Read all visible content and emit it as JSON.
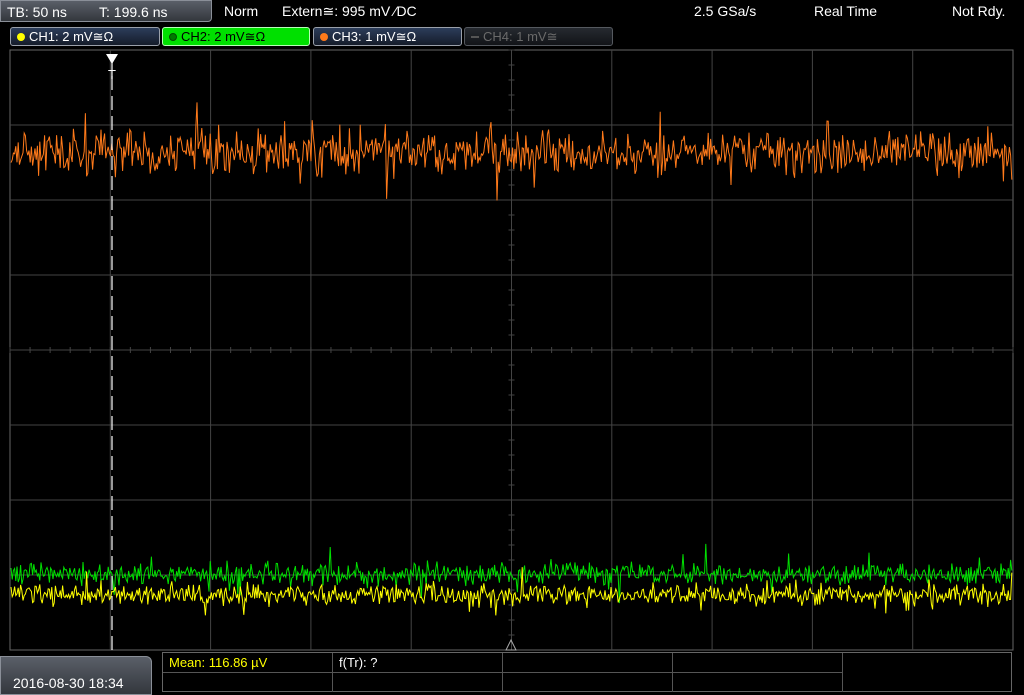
{
  "header": {
    "timebase": "TB: 50 ns",
    "trigger_time": "T: 199.6 ns",
    "trigger_mode": "Norm",
    "trigger_source": "Extern≅: 995 mV ⁄DC",
    "sample_rate": "2.5 GSa/s",
    "acq_mode": "Real Time",
    "status": "Not Rdy."
  },
  "channels": [
    {
      "label": "CH1: 2 mV≅Ω",
      "color": "#ffff00"
    },
    {
      "label": "CH2: 2 mV≅Ω",
      "color": "#00e000"
    },
    {
      "label": "CH3: 1 mV≅Ω",
      "color": "#ff7a1a"
    },
    {
      "label": "CH4: 1 mV≅",
      "color": "#777777"
    }
  ],
  "trigger_marker": "T",
  "footer": {
    "datetime": "2016-08-30 18:34",
    "mean": "Mean: 116.86 µV",
    "ftr": "f(Tr): ?"
  },
  "colors": {
    "grid": "#444444",
    "ch1": "#ffff00",
    "ch2": "#00e000",
    "ch3": "#ff7a1a",
    "meas_text": "#ffff00"
  }
}
